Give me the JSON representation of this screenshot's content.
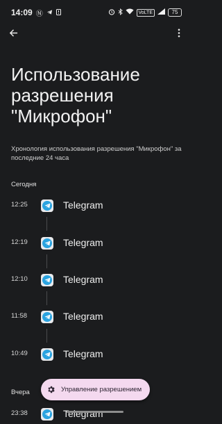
{
  "status_bar": {
    "time": "14:09",
    "notif_icons": [
      "nfc-icon",
      "telegram-icon",
      "alert-icon"
    ],
    "right_icons": [
      "alarm-icon",
      "bluetooth-icon",
      "wifi-icon"
    ],
    "volte": "VoLTE",
    "battery": "75"
  },
  "appbar": {
    "back_icon": "arrow-back-icon",
    "more_icon": "more-vert-icon"
  },
  "title": "Использование разрешения \"Микрофон\"",
  "description": "Хронология использования разрешения \"Микрофон\" за последние 24 часа",
  "sections": {
    "today": "Сегодня",
    "yesterday": "Вчера"
  },
  "today_items": [
    {
      "time": "12:25",
      "app": "Telegram"
    },
    {
      "time": "12:19",
      "app": "Telegram"
    },
    {
      "time": "12:10",
      "app": "Telegram"
    },
    {
      "time": "11:58",
      "app": "Telegram"
    },
    {
      "time": "10:49",
      "app": "Telegram"
    }
  ],
  "yesterday_items": [
    {
      "time": "23:38",
      "app": "Telegram"
    }
  ],
  "fab": {
    "label": "Управление разрешением",
    "icon": "settings-gear-icon"
  },
  "colors": {
    "background": "#1b1c1e",
    "fab": "#f4d9ef",
    "telegram": "#2aa3e0"
  }
}
